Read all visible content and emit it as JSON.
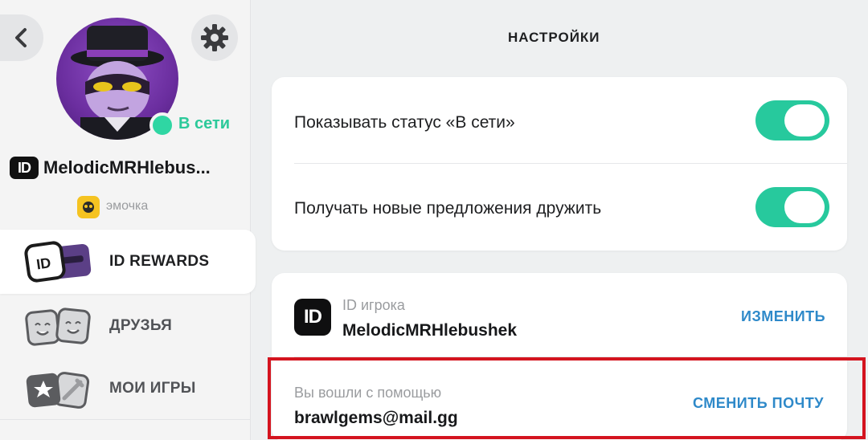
{
  "sidebar": {
    "online_status": "В сети",
    "id_badge": "ID",
    "username": "MelodicMRHlebus...",
    "club_name": "эмочка",
    "nav": [
      {
        "label": "ID REWARDS",
        "active": true
      },
      {
        "label": "ДРУЗЬЯ",
        "active": false
      },
      {
        "label": "МОИ ИГРЫ",
        "active": false
      }
    ]
  },
  "main": {
    "title": "НАСТРОЙКИ",
    "toggles": [
      {
        "label": "Показывать статус «В сети»",
        "on": true
      },
      {
        "label": "Получать новые предложения дружить",
        "on": true
      }
    ],
    "player_id": {
      "badge": "ID",
      "caption": "ID игрока",
      "value": "MelodicMRHlebushek",
      "action": "ИЗМЕНИТЬ"
    },
    "login": {
      "caption": "Вы вошли с помощью",
      "value": "brawlgems@mail.gg",
      "action": "СМЕНИТЬ ПОЧТУ"
    }
  },
  "colors": {
    "accent_green": "#27c99d",
    "link_blue": "#2e89c9",
    "highlight_red": "#d4141f"
  }
}
